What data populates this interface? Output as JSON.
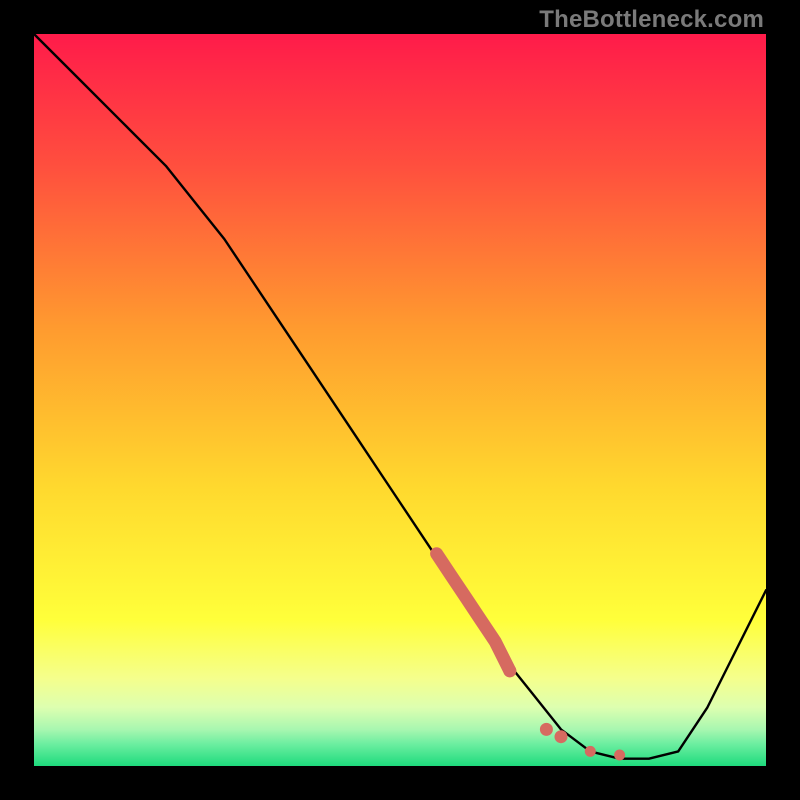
{
  "watermark": "TheBottleneck.com",
  "colors": {
    "gradient_top": "#ff1b4a",
    "gradient_mid1": "#ff7a2f",
    "gradient_mid2": "#ffe92e",
    "gradient_bottom_band1": "#f7ff8a",
    "gradient_bottom_band2": "#baffb0",
    "gradient_bottom": "#1edb7d",
    "curve": "#000000",
    "marker": "#d66a60",
    "frame_bg": "#000000"
  },
  "chart_data": {
    "type": "line",
    "title": "",
    "xlabel": "",
    "ylabel": "",
    "xlim": [
      0,
      100
    ],
    "ylim": [
      0,
      100
    ],
    "series": [
      {
        "name": "bottleneck-curve",
        "x": [
          0,
          6,
          12,
          18,
          22,
          26,
          32,
          38,
          44,
          50,
          56,
          60,
          64,
          68,
          72,
          76,
          80,
          84,
          88,
          92,
          96,
          100
        ],
        "y": [
          100,
          94,
          88,
          82,
          77,
          72,
          63,
          54,
          45,
          36,
          27,
          21,
          15,
          10,
          5,
          2,
          1,
          1,
          2,
          8,
          16,
          24
        ]
      }
    ],
    "highlight_segment": {
      "name": "highlight-dots",
      "x": [
        55,
        57,
        59,
        61,
        63,
        65,
        70,
        72,
        76,
        80
      ],
      "y": [
        29,
        26,
        23,
        20,
        17,
        13,
        5,
        4,
        2,
        1.5
      ]
    }
  }
}
